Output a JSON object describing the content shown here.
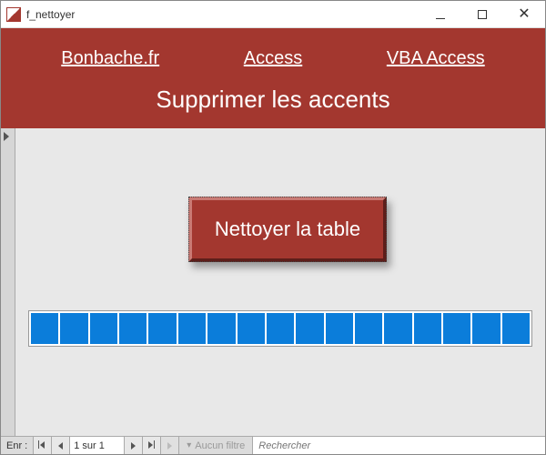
{
  "window": {
    "title": "f_nettoyer"
  },
  "header": {
    "links": [
      "Bonbache.fr",
      "Access",
      "VBA Access"
    ],
    "title": "Supprimer les accents"
  },
  "main": {
    "button_label": "Nettoyer la table",
    "progress_segments": 17
  },
  "recordnav": {
    "label": "Enr :",
    "position": "1 sur 1",
    "filter_text": "Aucun filtre",
    "search_placeholder": "Rechercher"
  }
}
